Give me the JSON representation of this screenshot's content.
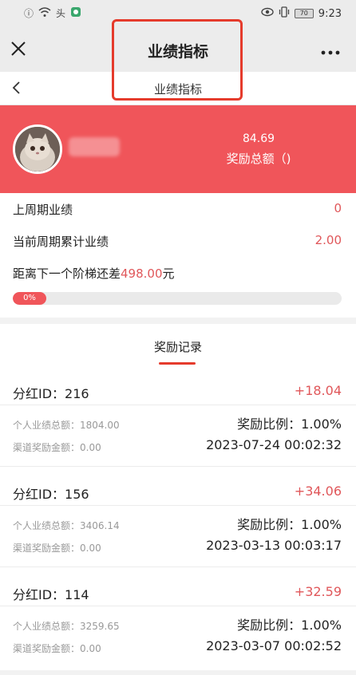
{
  "status_bar": {
    "time": "9:23",
    "battery": "70",
    "left_icons": [
      "alert-icon",
      "wifi-icon",
      "app-icon",
      "app-icon-2"
    ],
    "right_icons": [
      "eye-icon",
      "vibrate-icon",
      "battery-icon"
    ]
  },
  "top_bar": {
    "title": "业绩指标",
    "more": "•••"
  },
  "sub_bar": {
    "title": "业绩指标"
  },
  "hero": {
    "amount": "84.69",
    "label": "奖励总额（)"
  },
  "stats": {
    "last_period_label": "上周期业绩",
    "last_period_value": "0",
    "current_period_label": "当前周期累计业绩",
    "current_period_value": "2.00",
    "gap_prefix": "距离下一个阶梯还差",
    "gap_value": "498.00",
    "gap_suffix": "元",
    "progress_label": "0%",
    "progress_percent": 0
  },
  "records": {
    "heading": "奖励记录",
    "items": [
      {
        "id_label": "分红ID：216",
        "bonus": "+18.04",
        "personal_label": "个人业绩总额：1804.00",
        "channel_label": "渠道奖励金额：0.00",
        "ratio": "奖励比例：1.00%",
        "time": "2023-07-24 00:02:32"
      },
      {
        "id_label": "分红ID：156",
        "bonus": "+34.06",
        "personal_label": "个人业绩总额：3406.14",
        "channel_label": "渠道奖励金额：0.00",
        "ratio": "奖励比例：1.00%",
        "time": "2023-03-13 00:03:17"
      },
      {
        "id_label": "分红ID：114",
        "bonus": "+32.59",
        "personal_label": "个人业绩总额：3259.65",
        "channel_label": "渠道奖励金额：0.00",
        "ratio": "奖励比例：1.00%",
        "time": "2023-03-07 00:02:52"
      }
    ]
  },
  "colors": {
    "accent_red": "#f0555a",
    "value_red": "#e0575a",
    "highlight_box": "#e53b2c"
  }
}
